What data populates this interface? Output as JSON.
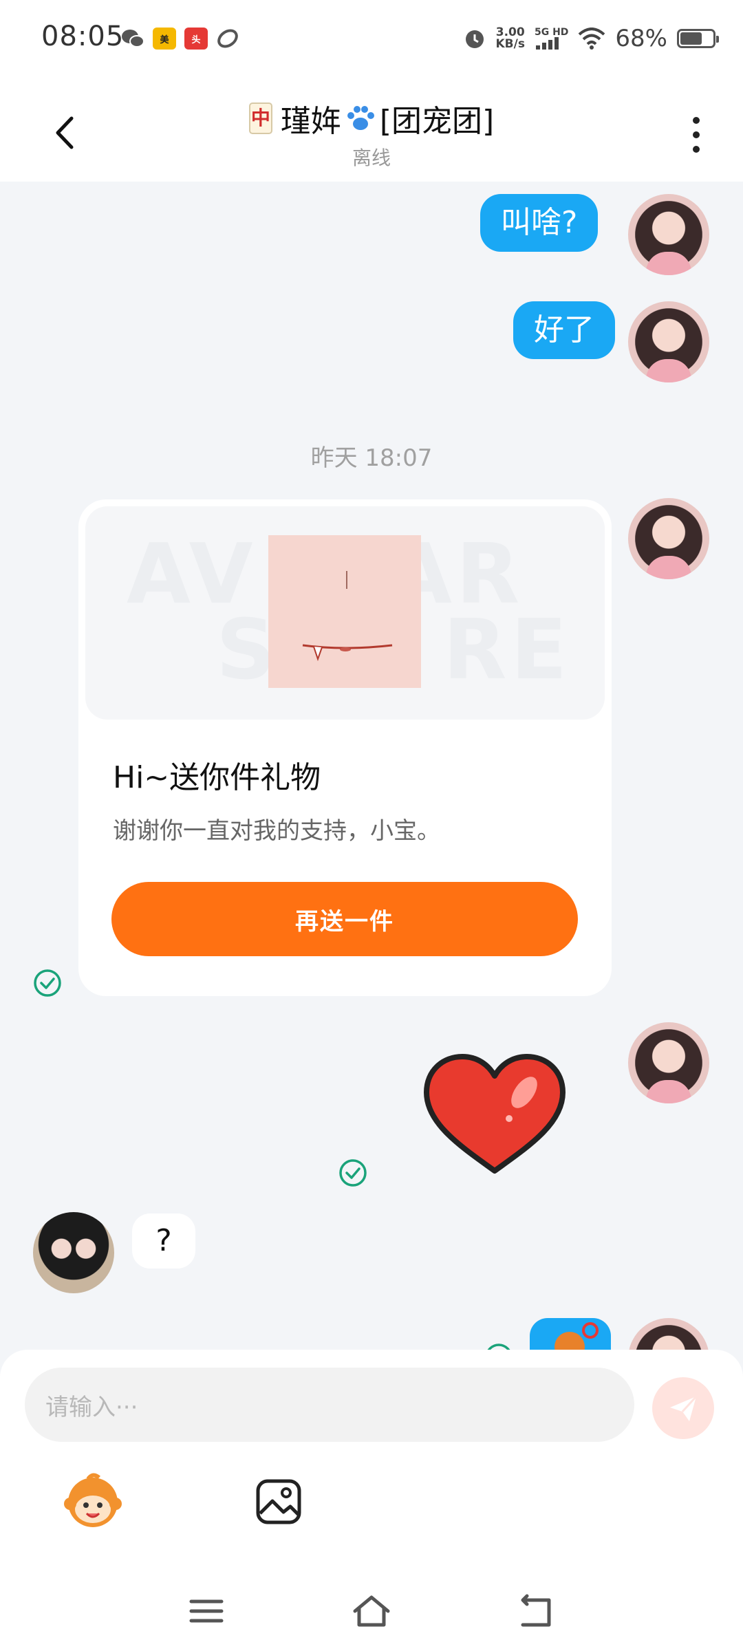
{
  "status_bar": {
    "time": "08:05",
    "net_speed_value": "3.00",
    "net_speed_unit": "KB/s",
    "network": "5G HD",
    "battery_text": "68%",
    "battery_level": 0.68,
    "app_icons": [
      "wechat-icon",
      "meituan-icon",
      "toutiao-icon",
      "link-icon"
    ]
  },
  "header": {
    "title_name": "瑾姩",
    "title_tag": "[团宠团]",
    "status": "离线"
  },
  "messages": {
    "m1": "叫啥?",
    "m2": "好了",
    "timestamp": "昨天 18:07",
    "gift": {
      "title": "Hi~送你件礼物",
      "description": "谢谢你一直对我的支持，小宝。",
      "button": "再送一件"
    },
    "m_other": "?"
  },
  "input": {
    "placeholder": "请输入···"
  },
  "colors": {
    "bubble_me": "#1aa8f4",
    "gift_button": "#ff7112",
    "read_check": "#1aa37a"
  }
}
